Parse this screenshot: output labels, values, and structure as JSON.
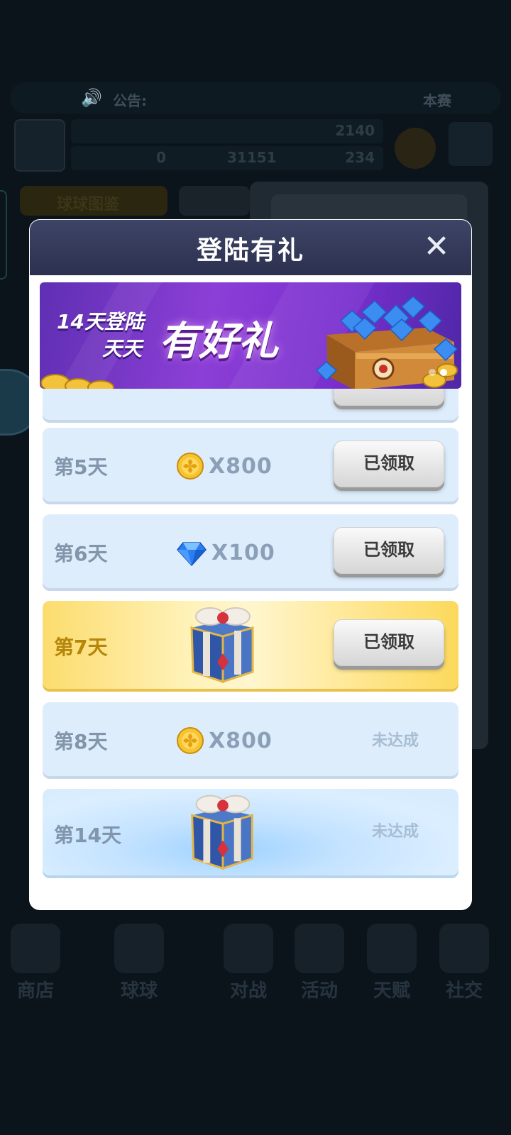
{
  "background": {
    "notice": {
      "label": "公告:",
      "right": "本赛"
    },
    "stats": {
      "trophies": "2140",
      "coins_left": "0",
      "coins": "31151",
      "gems": "234"
    },
    "tab1": "球球图鉴",
    "nav": [
      {
        "label": "商店"
      },
      {
        "label": "球球"
      },
      {
        "label": "对战"
      },
      {
        "label": "活动"
      },
      {
        "label": "天赋"
      },
      {
        "label": "社交"
      }
    ]
  },
  "modal": {
    "title": "登陆有礼",
    "close_symbol": "✕",
    "banner": {
      "line1": "14天登陆",
      "line2": "天天",
      "headline": "有好礼"
    },
    "rows": [
      {
        "day": "第5天",
        "reward_icon": "gold-coin-icon",
        "quantity": "X800",
        "status": "已领取",
        "claimed": true
      },
      {
        "day": "第6天",
        "reward_icon": "blue-diamond-icon",
        "quantity": "X100",
        "status": "已领取",
        "claimed": true
      },
      {
        "day": "第7天",
        "reward_icon": "gift-box-icon",
        "quantity": "",
        "status": "已领取",
        "claimed": true
      },
      {
        "day": "第8天",
        "reward_icon": "gold-coin-icon",
        "quantity": "X800",
        "status": "未达成",
        "claimed": false
      },
      {
        "day": "第14天",
        "reward_icon": "gift-box-icon",
        "quantity": "",
        "status": "未达成",
        "claimed": false
      }
    ]
  },
  "colors": {
    "header": "#343a5a",
    "row_bg": "#deedfc",
    "gold_row": "#fde27a",
    "claimed_button": "#e6e6e6",
    "muted_text": "#8195ab"
  }
}
